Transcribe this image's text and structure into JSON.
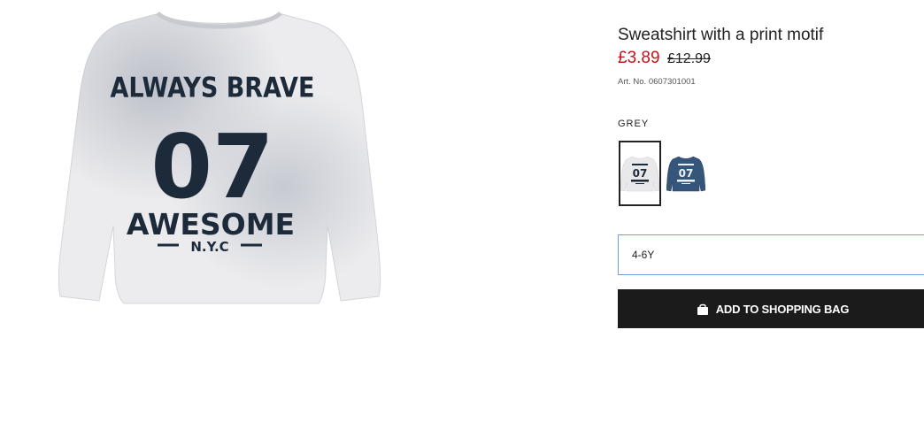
{
  "product": {
    "title": "Sweatshirt with a print motif",
    "price_sale": "£3.89",
    "price_original": "£12.99",
    "article_number": "Art. No. 0607301001",
    "image_icon": "sweatshirt-image",
    "print": {
      "line1": "ALWAYS BRAVE",
      "line2": "07",
      "line3": "AWESOME",
      "line4": "N.Y.C"
    }
  },
  "color": {
    "label": "GREY",
    "swatches": [
      {
        "name": "grey",
        "selected": true,
        "fill": "#e9e9eb",
        "print_color": "#1d2a3a"
      },
      {
        "name": "blue",
        "selected": false,
        "fill": "#35557a",
        "print_color": "#eef2f6"
      }
    ]
  },
  "size": {
    "selected": "4-6Y"
  },
  "actions": {
    "add_to_bag_label": "ADD TO SHOPPING BAG",
    "bag_icon": "shopping-bag-icon"
  },
  "colors": {
    "sale_price": "#c4141c",
    "button_bg": "#1b1b1b",
    "select_border": "#6e9fd8"
  }
}
